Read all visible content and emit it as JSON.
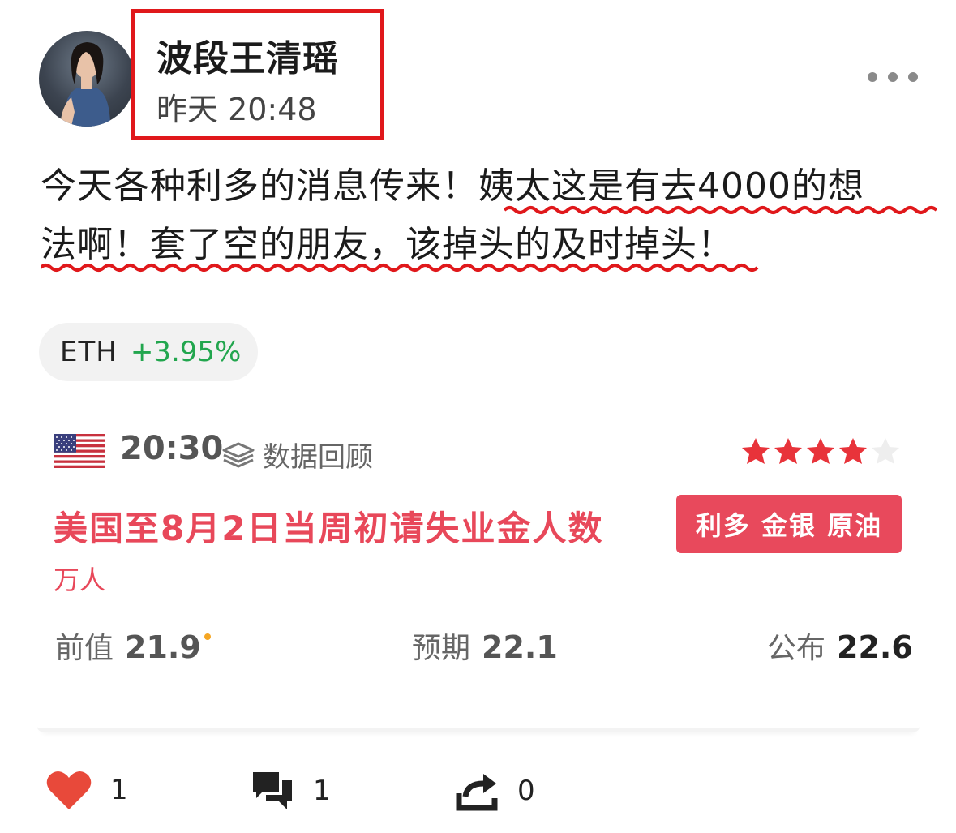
{
  "author": {
    "name": "波段王清瑶",
    "time": "昨天 20:48"
  },
  "post": {
    "text_plain": "今天各种利多的消息传来！",
    "text_underlined_1": "姨太这是有去4000的想",
    "text_underlined_2": "法啊！套了空的朋友，该掉头的及时掉头！"
  },
  "coin": {
    "symbol": "ETH",
    "change": "+3.95%"
  },
  "event": {
    "time": "20:30",
    "review_label": "数据回顾",
    "importance_stars": 4,
    "max_stars": 5,
    "title": "美国至8月2日当周初请失业金人数",
    "unit": "万人",
    "impact": "利多 金银 原油",
    "previous_label": "前值",
    "previous_value": "21.9",
    "forecast_label": "预期",
    "forecast_value": "22.1",
    "actual_label": "公布",
    "actual_value": "22.6"
  },
  "actions": {
    "likes": "1",
    "comments": "1",
    "shares": "0"
  },
  "colors": {
    "highlight_red": "#e0181b",
    "event_red": "#e8485a",
    "positive_green": "#22a64e",
    "star_red": "#e8333a"
  },
  "icons": {
    "more": "more-dots-icon",
    "review": "layers-icon",
    "like": "heart-icon",
    "comment": "comment-bubbles-icon",
    "share": "share-icon",
    "flag": "us-flag-icon"
  }
}
